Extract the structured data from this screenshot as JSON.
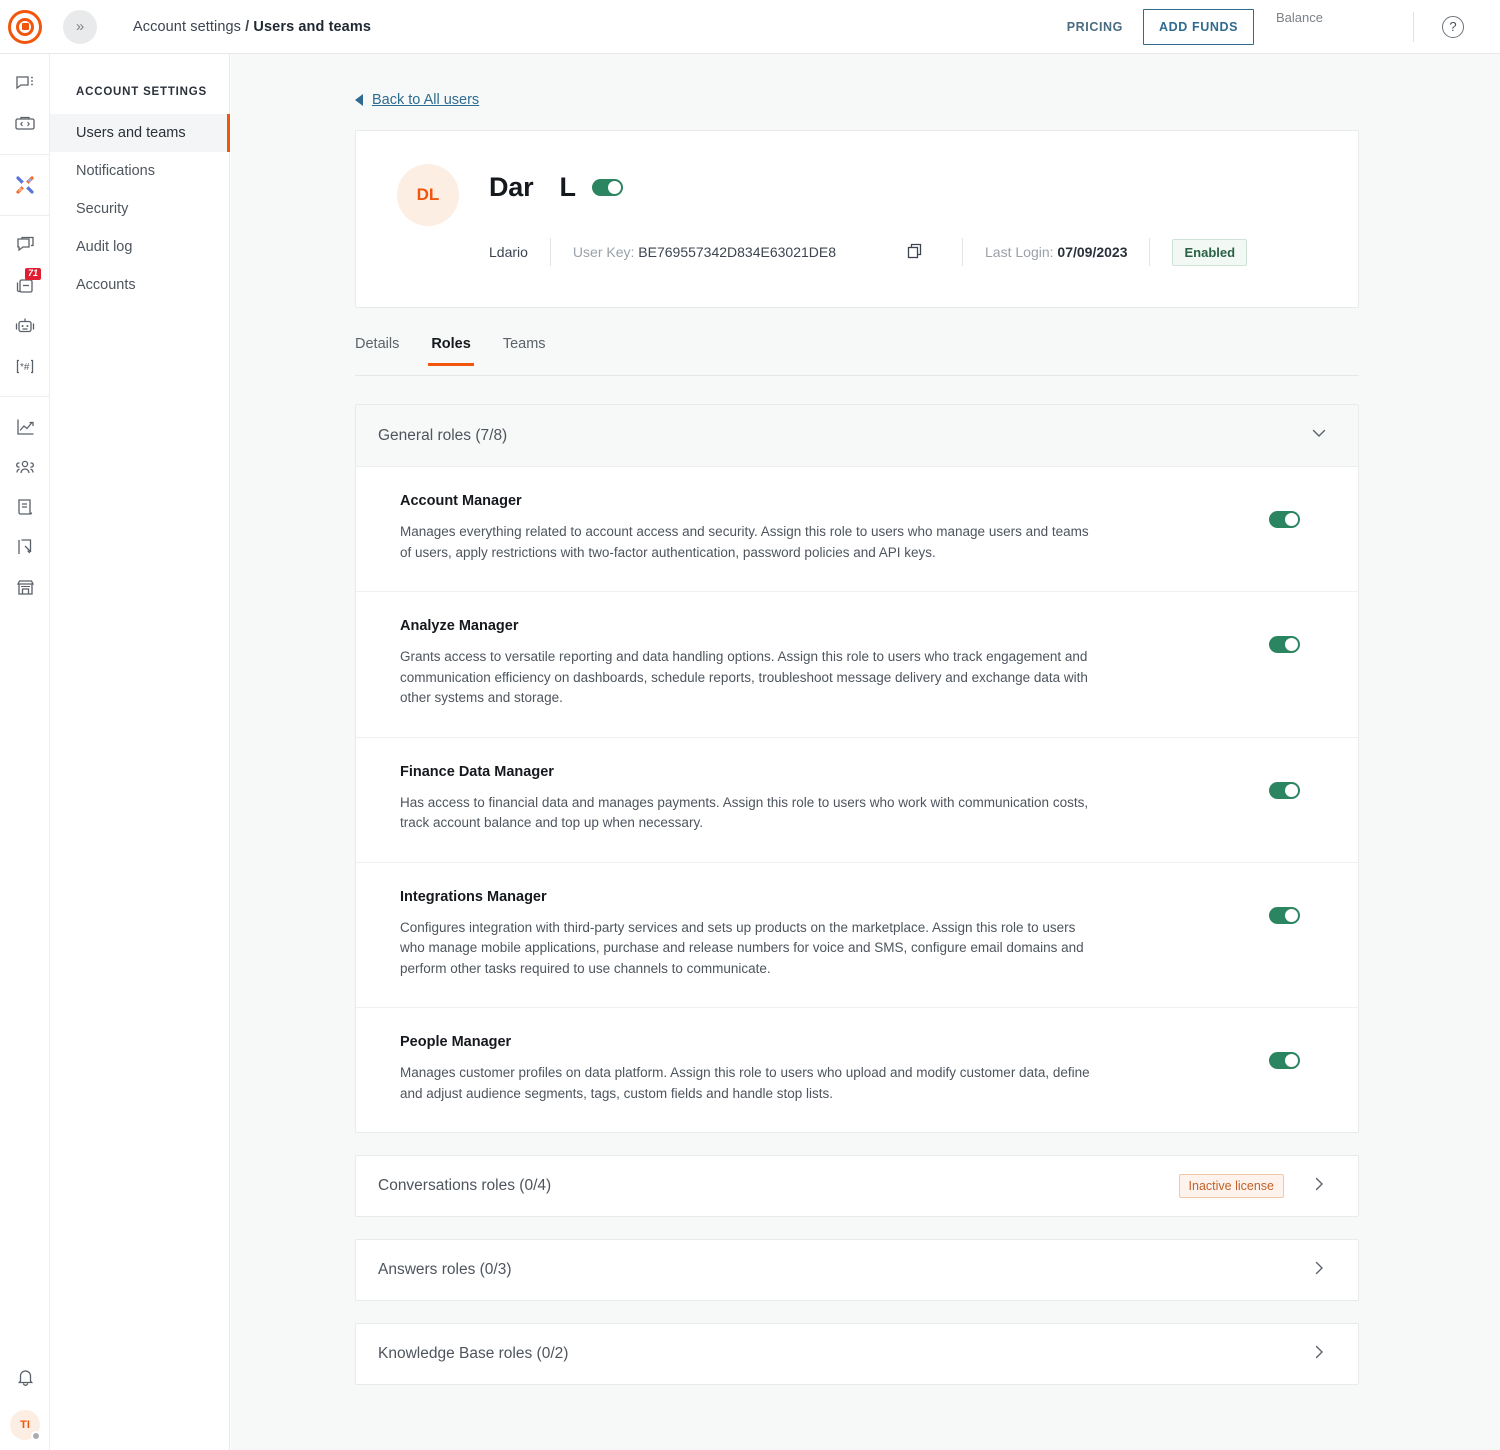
{
  "topbar": {
    "logo_icon": "target-logo-icon",
    "collapse_icon": "double-chevron-right-icon",
    "breadcrumb_parent": "Account settings",
    "breadcrumb_sep": "/",
    "breadcrumb_current": "Users and teams",
    "pricing_label": "PRICING",
    "add_funds_label": "ADD FUNDS",
    "balance_label": "Balance",
    "help_label": "?"
  },
  "rail": {
    "groups": [
      {
        "items": [
          {
            "name": "chat-menu-icon"
          },
          {
            "name": "developer-toolbox-icon"
          }
        ]
      },
      {
        "items": [
          {
            "name": "crossover-brand-icon"
          }
        ]
      },
      {
        "items": [
          {
            "name": "broadcast-messages-icon"
          },
          {
            "name": "inbox-icon",
            "badge": "71"
          },
          {
            "name": "chatbot-icon"
          },
          {
            "name": "number-lookup-icon"
          }
        ]
      },
      {
        "items": [
          {
            "name": "analytics-chart-icon"
          },
          {
            "name": "audience-people-icon"
          },
          {
            "name": "documents-icon"
          },
          {
            "name": "flows-icon"
          },
          {
            "name": "marketplace-store-icon"
          }
        ]
      }
    ],
    "bottom": {
      "bell_icon": "notification-bell-icon",
      "avatar_initials": "TI"
    }
  },
  "settings_nav": {
    "title": "ACCOUNT SETTINGS",
    "items": [
      {
        "label": "Users and teams",
        "active": true
      },
      {
        "label": "Notifications",
        "active": false
      },
      {
        "label": "Security",
        "active": false
      },
      {
        "label": "Audit log",
        "active": false
      },
      {
        "label": "Accounts",
        "active": false
      }
    ]
  },
  "main": {
    "back_link": "Back to All users",
    "profile": {
      "avatar_initials": "DL",
      "first_name": "Dar",
      "last_name": "L",
      "enabled_toggle": true,
      "username": "Ldario",
      "user_key_label": "User Key:",
      "user_key_value": "BE769557342D834E63021DE8",
      "copy_icon": "copy-icon",
      "last_login_label": "Last Login:",
      "last_login_value": "07/09/2023",
      "status_badge": "Enabled"
    },
    "tabs": [
      {
        "label": "Details",
        "active": false
      },
      {
        "label": "Roles",
        "active": true
      },
      {
        "label": "Teams",
        "active": false
      }
    ],
    "general_roles": {
      "header": "General roles (7/8)",
      "expanded": true,
      "roles": [
        {
          "name": "Account Manager",
          "description": "Manages everything related to account access and security. Assign this role to users who manage users and teams of users, apply restrictions with two-factor authentication, password policies and API keys.",
          "enabled": true
        },
        {
          "name": "Analyze Manager",
          "description": "Grants access to versatile reporting and data handling options. Assign this role to users who track engagement and communication efficiency on dashboards, schedule reports, troubleshoot message delivery and exchange data with other systems and storage.",
          "enabled": true
        },
        {
          "name": "Finance Data Manager",
          "description": "Has access to financial data and manages payments. Assign this role to users who work with communication costs, track account balance and top up when necessary.",
          "enabled": true
        },
        {
          "name": "Integrations Manager",
          "description": "Configures integration with third-party services and sets up products on the marketplace. Assign this role to users who manage mobile applications, purchase and release numbers for voice and SMS, configure email domains and perform other tasks required to use channels to communicate.",
          "enabled": true
        },
        {
          "name": "People Manager",
          "description": "Manages customer profiles on data platform. Assign this role to users who upload and modify customer data, define and adjust audience segments, tags, custom fields and handle stop lists.",
          "enabled": true
        }
      ]
    },
    "collapsed_sections": [
      {
        "header": "Conversations roles (0/4)",
        "badge": "Inactive license"
      },
      {
        "header": "Answers roles (0/3)",
        "badge": null
      },
      {
        "header": "Knowledge Base roles (0/2)",
        "badge": null
      }
    ]
  },
  "colors": {
    "brand_orange": "#f2560d",
    "toggle_green": "#2a8560",
    "link_blue": "#2f6b8f",
    "badge_red": "#e01e32",
    "license_amber": "#c2622a"
  }
}
